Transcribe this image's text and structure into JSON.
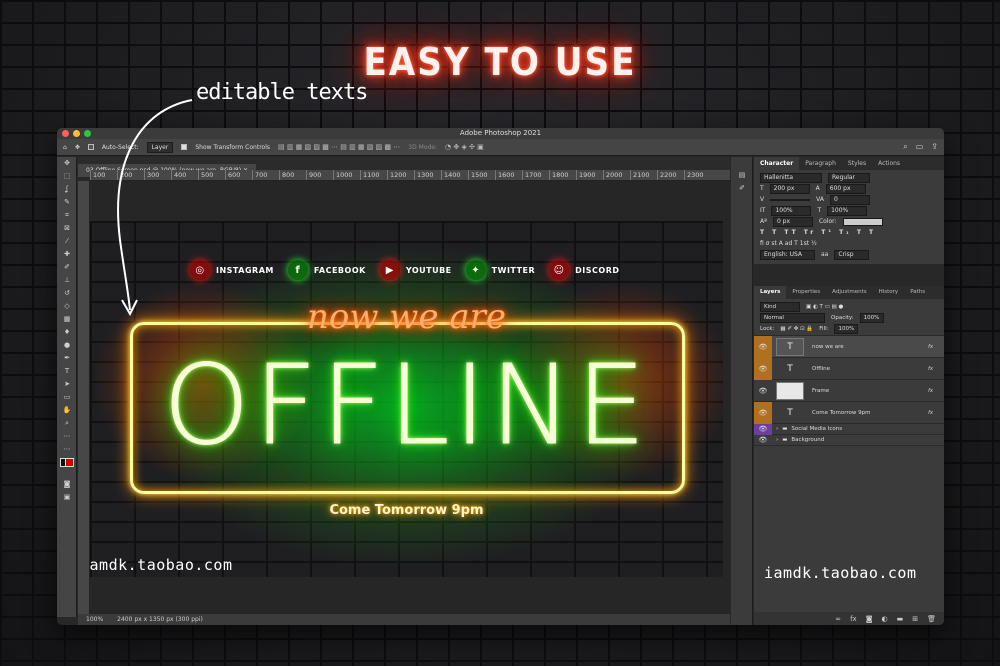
{
  "headline": "EASY TO USE",
  "annotation": "editable texts",
  "watermark": "iamdk.taobao.com",
  "photoshop": {
    "app_title": "Adobe Photoshop 2021",
    "options": {
      "auto_select_label": "Auto-Select:",
      "auto_select_value": "Layer",
      "transform_label": "Show Transform Controls",
      "mode_3d": "3D Mode:"
    },
    "doc_tab": "03 Offline Screen.psd @ 100% (now we are, RGB/8)",
    "ruler": [
      "100",
      "200",
      "300",
      "400",
      "500",
      "600",
      "700",
      "800",
      "900",
      "1000",
      "1100",
      "1200",
      "1300",
      "1400",
      "1500",
      "1600",
      "1700",
      "1800",
      "1900",
      "2000",
      "2100",
      "2200",
      "2300"
    ],
    "status": {
      "zoom": "100%",
      "size": "2400 px x 1350 px (300 ppi)"
    },
    "canvas": {
      "social": [
        {
          "icon": "instagram-icon",
          "glyph": "◎",
          "label": "INSTAGRAM",
          "tone": "red"
        },
        {
          "icon": "facebook-icon",
          "glyph": "f",
          "label": "FACEBOOK",
          "tone": "grn"
        },
        {
          "icon": "youtube-icon",
          "glyph": "▶",
          "label": "YOUTUBE",
          "tone": "red"
        },
        {
          "icon": "twitter-icon",
          "glyph": "✦",
          "label": "TWITTER",
          "tone": "grn"
        },
        {
          "icon": "discord-icon",
          "glyph": "☺",
          "label": "DISCORD",
          "tone": "red"
        }
      ],
      "now_we_are": "now we are",
      "offline": "OFFLINE",
      "tomorrow": "Come Tomorrow 9pm"
    },
    "character_panel": {
      "tabs": [
        "Character",
        "Paragraph",
        "Styles",
        "Actions"
      ],
      "font_family": "Hallenitta",
      "font_style": "Regular",
      "font_size": "200 px",
      "leading": "600 px",
      "kerning": "",
      "tracking": "0",
      "vertical_scale": "100%",
      "horizontal_scale": "100%",
      "baseline": "0 px",
      "color_label": "Color:",
      "language": "English: USA",
      "anti_alias": "Crisp"
    },
    "layers_panel": {
      "tabs": [
        "Layers",
        "Properties",
        "Adjustments",
        "History",
        "Paths"
      ],
      "kind": "Kind",
      "blend_mode": "Normal",
      "opacity_label": "Opacity:",
      "opacity": "100%",
      "lock_label": "Lock:",
      "fill_label": "Fill:",
      "fill": "100%",
      "layers": [
        {
          "name": "now we are",
          "type": "text",
          "marker": "orange",
          "selected": true
        },
        {
          "name": "Offline",
          "type": "text",
          "marker": "orange",
          "selected": false
        },
        {
          "name": "Frame",
          "type": "image",
          "marker": "orange",
          "selected": false
        },
        {
          "name": "Come Tomorrow 9pm",
          "type": "text",
          "marker": "orange",
          "selected": false
        },
        {
          "name": "Social Media Icons",
          "type": "group",
          "marker": "purple",
          "selected": false
        },
        {
          "name": "Background",
          "type": "group",
          "marker": "",
          "selected": false
        }
      ]
    }
  }
}
